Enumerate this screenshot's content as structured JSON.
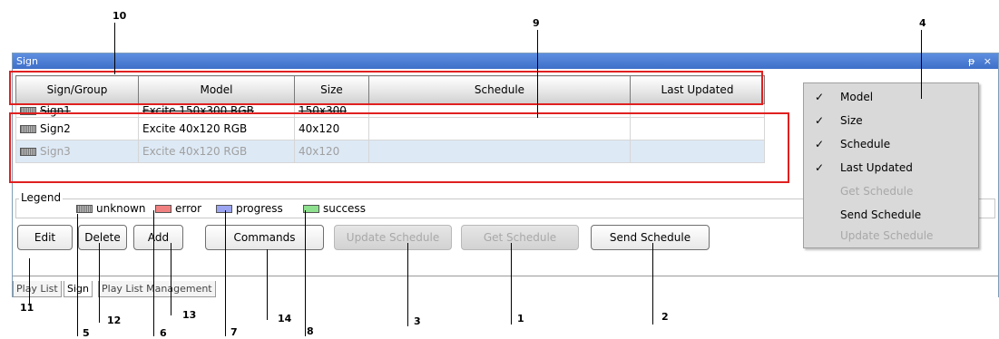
{
  "window": {
    "title": "Sign",
    "pin_glyph": "ᵽ",
    "close_glyph": "×"
  },
  "grid": {
    "columns": [
      "Sign/Group",
      "Model",
      "Size",
      "Schedule",
      "Last Updated"
    ],
    "rows": [
      {
        "name": "Sign1",
        "model": "Excite 150x300 RGB",
        "size": "150x300",
        "schedule": "",
        "last_updated": "",
        "status": "unknown"
      },
      {
        "name": "Sign2",
        "model": "Excite 40x120 RGB",
        "size": "40x120",
        "schedule": "",
        "last_updated": "",
        "status": "unknown"
      },
      {
        "name": "Sign3",
        "model": "Excite 40x120 RGB",
        "size": "40x120",
        "schedule": "",
        "last_updated": "",
        "status": "unknown"
      }
    ]
  },
  "context_menu": {
    "items": [
      {
        "label": "Model",
        "checked": "✓",
        "enabled": true
      },
      {
        "label": "Size",
        "checked": "✓",
        "enabled": true
      },
      {
        "label": "Schedule",
        "checked": "✓",
        "enabled": true
      },
      {
        "label": "Last Updated",
        "checked": "✓",
        "enabled": true
      },
      {
        "label": "Get Schedule",
        "checked": "",
        "enabled": false
      },
      {
        "label": "Send Schedule",
        "checked": "",
        "enabled": true
      },
      {
        "label": "Update Schedule",
        "checked": "",
        "enabled": false
      }
    ]
  },
  "legend": {
    "title": "Legend",
    "items": [
      {
        "label": "unknown",
        "color": "#999999"
      },
      {
        "label": "error",
        "color": "#f08080"
      },
      {
        "label": "progress",
        "color": "#9aa4f0"
      },
      {
        "label": "success",
        "color": "#8de08d"
      }
    ]
  },
  "buttons": {
    "edit": "Edit",
    "delete": "Delete",
    "add": "Add",
    "commands": "Commands",
    "update_schedule": "Update Schedule",
    "get_schedule": "Get Schedule",
    "send_schedule": "Send Schedule"
  },
  "tabs": [
    "Play List",
    "Sign",
    "Play List Management"
  ],
  "callouts": [
    "1",
    "2",
    "3",
    "4",
    "5",
    "6",
    "7",
    "8",
    "9",
    "10",
    "11",
    "12",
    "13",
    "14"
  ],
  "colors": {
    "highlight_box": "#e02020",
    "title_bar": "#3f6fc9"
  }
}
